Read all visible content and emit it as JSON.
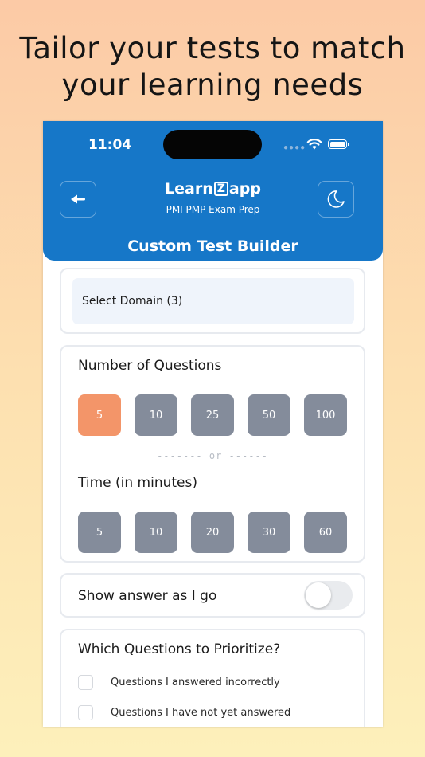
{
  "promo": {
    "line1": "Tailor your tests to match",
    "line2": "your learning needs"
  },
  "status_bar": {
    "time": "11:04",
    "icons": [
      "cellular-dots-icon",
      "wifi-icon",
      "battery-icon"
    ]
  },
  "header": {
    "logo_part1": "Learn",
    "logo_z": "Z",
    "logo_part2": "app",
    "subtitle": "PMI PMP Exam Prep",
    "title": "Custom Test Builder",
    "back_icon": "arrow-left-icon",
    "theme_icon": "moon-icon"
  },
  "domain": {
    "label": "Select Domain (3)"
  },
  "questions": {
    "label": "Number of Questions",
    "options": [
      "5",
      "10",
      "25",
      "50",
      "100"
    ],
    "selected": "5"
  },
  "divider": {
    "label": "------- or ------"
  },
  "time": {
    "label": "Time (in minutes)",
    "options": [
      "5",
      "10",
      "20",
      "30",
      "60"
    ]
  },
  "show_answer": {
    "label": "Show answer as I go",
    "enabled": false
  },
  "priority": {
    "label": "Which Questions to Prioritize?",
    "options": [
      "Questions I answered incorrectly",
      "Questions I have not yet answered"
    ]
  },
  "colors": {
    "brand_blue": "#1677c8",
    "chip_gray": "#848c9b",
    "chip_active": "#f39569"
  }
}
